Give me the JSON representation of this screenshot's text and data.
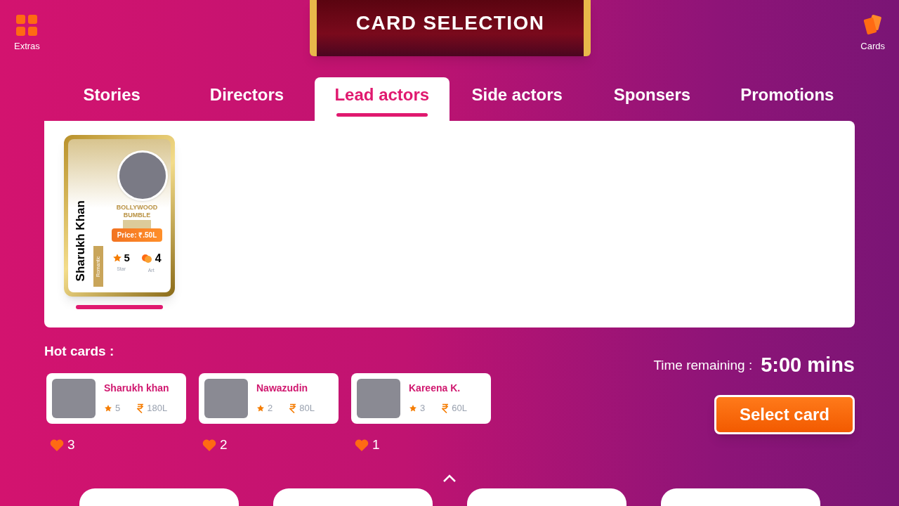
{
  "header": {
    "title": "CARD SELECTION",
    "left_button": "Extras",
    "right_button": "Cards"
  },
  "tabs": [
    {
      "label": "Stories",
      "selected": false
    },
    {
      "label": "Directors",
      "selected": false
    },
    {
      "label": "Lead actors",
      "selected": true
    },
    {
      "label": "Side actors",
      "selected": false
    },
    {
      "label": "Sponsers",
      "selected": false
    },
    {
      "label": "Promotions",
      "selected": false
    }
  ],
  "cards": [
    {
      "name": "Sharukh Khan",
      "genre": "Romantic",
      "logo_text": "BOLLYWOOD BUMBLE",
      "price": "Price: ₹.50L",
      "star_value": "5",
      "star_label": "Star",
      "art_value": "4",
      "art_label": "Art",
      "selected": true
    }
  ],
  "hot_cards": {
    "title": "Hot cards  :",
    "items": [
      {
        "name": "Sharukh khan",
        "stars": "5",
        "price": "180L",
        "likes": "3"
      },
      {
        "name": "Nawazudin",
        "stars": "2",
        "price": "80L",
        "likes": "2"
      },
      {
        "name": "Kareena K.",
        "stars": "3",
        "price": "60L",
        "likes": "1"
      }
    ]
  },
  "timer": {
    "label": "Time remaining :",
    "value": "5:00 mins"
  },
  "select_button": "Select card"
}
